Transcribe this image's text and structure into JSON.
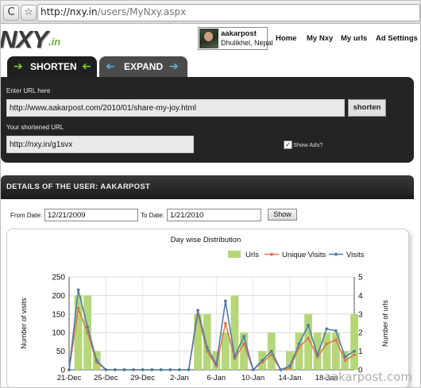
{
  "browser": {
    "reload_glyph": "C",
    "bookmark_glyph": "☆",
    "url_host": "http://nxy.in",
    "url_path": "/users/MyNxy.aspx"
  },
  "site": {
    "logo": "NXY",
    "logo_suffix": ".in",
    "user": {
      "name": "aakarpost",
      "location": "Dhulikhel, Nepal"
    },
    "nav": [
      "Home",
      "My Nxy",
      "My urls",
      "Ad Settings"
    ]
  },
  "tabs": {
    "shorten": {
      "label": "SHORTEN",
      "arrow_left": "➔",
      "arrow_right": "➔"
    },
    "expand": {
      "label": "EXPAND",
      "arrow_left": "➔",
      "arrow_right": "➔"
    }
  },
  "shorten_panel": {
    "enter_label": "Enter URL here",
    "long_url": "http://www.aakarpost.com/2010/01/share-my-joy.html",
    "shorten_button": "shorten",
    "short_label": "Your shortened URL",
    "short_url": "http://nxy.in/g1svx",
    "show_ads_checked": true,
    "show_ads_label": "Show Ads?"
  },
  "details": {
    "title": "DETAILS OF THE USER: AAKARPOST"
  },
  "date_filter": {
    "from_label": "From Date:",
    "from_value": "12/21/2009",
    "to_label": "To Date:",
    "to_value": "1/21/2010",
    "show_button": "Show"
  },
  "colors": {
    "urls": "#b5d779",
    "unique": "#e0784a",
    "visits": "#4f7eab",
    "accent_green": "#77d02d",
    "accent_blue": "#5fb4e6"
  },
  "watermark": "aakarpost.com",
  "chart_data": {
    "type": "bar+line",
    "title": "Day wise Distribution",
    "ylabel": "Number of visits",
    "y2label": "Number of urls",
    "ylim": [
      0,
      250
    ],
    "y2lim": [
      0,
      5
    ],
    "yticks": [
      0,
      50,
      100,
      150,
      200,
      250
    ],
    "y2ticks": [
      0,
      1,
      2,
      3,
      4,
      5
    ],
    "grid": true,
    "legend_position": "top-right",
    "x": [
      "21-Dec",
      "22-Dec",
      "23-Dec",
      "24-Dec",
      "25-Dec",
      "26-Dec",
      "27-Dec",
      "28-Dec",
      "29-Dec",
      "30-Dec",
      "31-Dec",
      "1-Jan",
      "2-Jan",
      "3-Jan",
      "4-Jan",
      "5-Jan",
      "6-Jan",
      "7-Jan",
      "8-Jan",
      "9-Jan",
      "10-Jan",
      "11-Jan",
      "12-Jan",
      "13-Jan",
      "14-Jan",
      "15-Jan",
      "16-Jan",
      "17-Jan",
      "18-Jan",
      "19-Jan",
      "20-Jan",
      "21-Jan"
    ],
    "xtick_labels": [
      "21-Dec",
      "25-Dec",
      "29-Dec",
      "2-Jan",
      "6-Jan",
      "10-Jan",
      "14-Jan",
      "18-Jan"
    ],
    "series": [
      {
        "name": "Urls",
        "axis": "right",
        "kind": "bar",
        "values": [
          0,
          4,
          4,
          1,
          0,
          0,
          0,
          0,
          0,
          0,
          0,
          0,
          0,
          0,
          3,
          3,
          1,
          2,
          4,
          2,
          0,
          1,
          2,
          0,
          1,
          2,
          3,
          2,
          2,
          2,
          1,
          3
        ]
      },
      {
        "name": "Unique Visits",
        "axis": "left",
        "kind": "line",
        "values": [
          0,
          165,
          100,
          20,
          0,
          0,
          0,
          0,
          0,
          0,
          0,
          0,
          0,
          0,
          150,
          50,
          10,
          125,
          30,
          70,
          0,
          20,
          40,
          0,
          5,
          60,
          85,
          35,
          70,
          80,
          25,
          40
        ]
      },
      {
        "name": "Visits",
        "axis": "left",
        "kind": "line",
        "values": [
          0,
          215,
          115,
          25,
          0,
          0,
          0,
          0,
          0,
          0,
          0,
          0,
          0,
          0,
          160,
          60,
          15,
          185,
          35,
          90,
          0,
          25,
          50,
          0,
          10,
          70,
          120,
          40,
          110,
          105,
          35,
          50
        ]
      }
    ]
  }
}
